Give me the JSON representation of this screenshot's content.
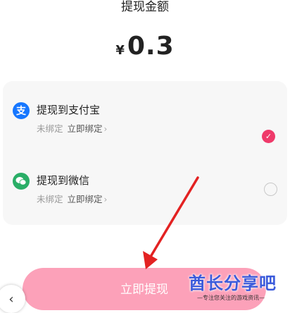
{
  "title": "提现金额",
  "amount": {
    "currency": "¥",
    "value": "0.3"
  },
  "options": [
    {
      "name": "提现到支付宝",
      "status": "未绑定",
      "action": "立即绑定",
      "chevron": "›",
      "icon": "alipay-icon",
      "selected": true,
      "icon_color": "#1677ff"
    },
    {
      "name": "提现到微信",
      "status": "未绑定",
      "action": "立即绑定",
      "chevron": "›",
      "icon": "wechat-icon",
      "selected": false,
      "icon_color": "#2aae67"
    }
  ],
  "alipay_glyph": "支",
  "check_glyph": "✓",
  "submit_label": "立即提现",
  "back_glyph": "‹",
  "watermark": {
    "brand": "酋长分享吧",
    "slogan": "—专注您关注的游戏资讯—"
  },
  "colors": {
    "accent": "#ef3a6a",
    "button": "#fca1b9",
    "arrow": "#e32222"
  }
}
